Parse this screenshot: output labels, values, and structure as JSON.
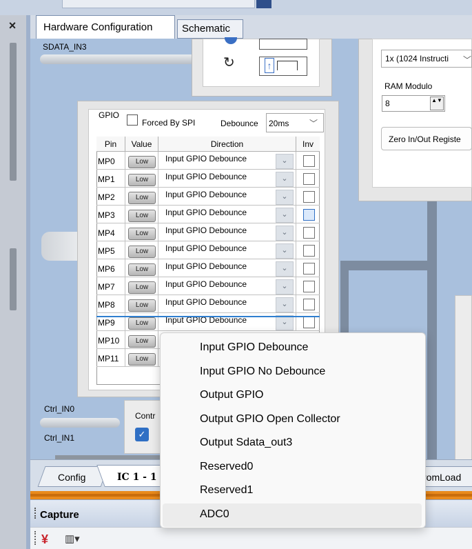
{
  "left_panel": {
    "close_glyph": "×"
  },
  "tabs": [
    {
      "label": "Hardware Configuration"
    },
    {
      "label": "Schematic"
    }
  ],
  "canvas": {
    "sdata_label": "SDATA_IN3",
    "ctrl_in0_label": "Ctrl_IN0",
    "ctrl_in1_label": "Ctrl_IN1",
    "contr_label": "Contr",
    "contr_checked_glyph": "✓"
  },
  "clock_block": {
    "up_glyph": "↑",
    "rotate_glyph": "↻"
  },
  "right_panel": {
    "program_length_value": "1x (1024 Instructi",
    "chevron": "﹀",
    "ram_modulo_label": "RAM Modulo",
    "ram_modulo_value": "8",
    "spin_glyph": "▲▼",
    "zero_button_label": "Zero In/Out Registe"
  },
  "gpio": {
    "title": "GPIO",
    "forced_by_spi_label": "Forced By SPI",
    "debounce_label": "Debounce",
    "debounce_value": "20ms",
    "chevron": "﹀",
    "headers": {
      "pin": "Pin",
      "value": "Value",
      "direction": "Direction",
      "inv": "Inv"
    },
    "rows": [
      {
        "pin": "MP0",
        "value": "Low",
        "direction": "Input  GPIO Debounce"
      },
      {
        "pin": "MP1",
        "value": "Low",
        "direction": "Input  GPIO Debounce"
      },
      {
        "pin": "MP2",
        "value": "Low",
        "direction": "Input  GPIO Debounce"
      },
      {
        "pin": "MP3",
        "value": "Low",
        "direction": "Input  GPIO Debounce"
      },
      {
        "pin": "MP4",
        "value": "Low",
        "direction": "Input  GPIO Debounce"
      },
      {
        "pin": "MP5",
        "value": "Low",
        "direction": "Input  GPIO Debounce"
      },
      {
        "pin": "MP6",
        "value": "Low",
        "direction": "Input  GPIO Debounce"
      },
      {
        "pin": "MP7",
        "value": "Low",
        "direction": "Input  GPIO Debounce"
      },
      {
        "pin": "MP8",
        "value": "Low",
        "direction": "Input  GPIO Debounce"
      },
      {
        "pin": "MP9",
        "value": "Low",
        "direction": "Input  GPIO Debounce"
      },
      {
        "pin": "MP10",
        "value": "Low",
        "direction": ""
      },
      {
        "pin": "MP11",
        "value": "Low",
        "direction": ""
      }
    ],
    "dropdown_glyph": "⌄"
  },
  "bottom_tabs": {
    "config": "Config",
    "ic1": "IC 1 - 1",
    "eeprom": "romLoad"
  },
  "capture": {
    "title": "Capture",
    "clear_icon_glyph": "¥",
    "columns_icon_glyph": "▥▾"
  },
  "direction_menu": {
    "items": [
      "Input  GPIO Debounce",
      "Input  GPIO No Debounce",
      "Output GPIO",
      "Output GPIO Open Collector",
      "Output Sdata_out3",
      "Reserved0",
      "Reserved1",
      "ADC0"
    ],
    "hovered_item": "ADC0"
  },
  "colors": {
    "canvas_bg": "#a9c0dd",
    "accent_blue": "#2f6fc4",
    "capture_divider": "#e98a1c"
  }
}
